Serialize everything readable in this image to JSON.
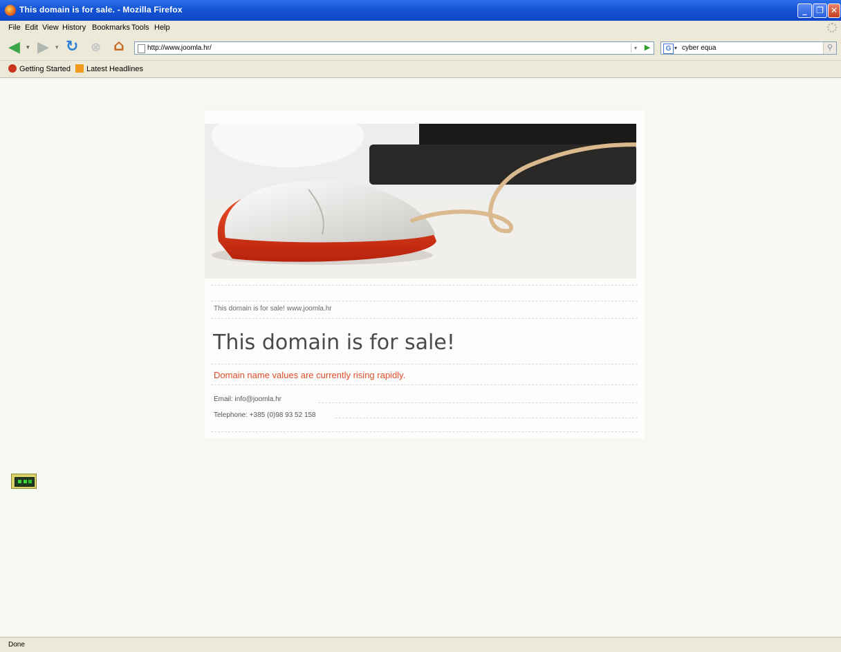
{
  "window": {
    "title": "This domain is for sale. - Mozilla Firefox"
  },
  "menu": [
    "File",
    "Edit",
    "View",
    "History",
    "Bookmarks",
    "Tools",
    "Help"
  ],
  "navigation": {
    "url": "http://www.joomla.hr/",
    "search_value": "cyber equa"
  },
  "bookmarks": [
    "Getting Started",
    "Latest Headlines"
  ],
  "page": {
    "breadcrumb": "This domain is for sale! www.joomla.hr",
    "headline": "This domain is for sale!",
    "subheadline": "Domain name values are currently rising rapidly.",
    "email": "Email: info@joomla.hr",
    "telephone": "Telephone: +385 (0)98 93 52 158"
  },
  "status": {
    "text": "Done"
  },
  "colors": {
    "accent_red": "#e14b2a",
    "titlebar_blue": "#1556d6"
  }
}
